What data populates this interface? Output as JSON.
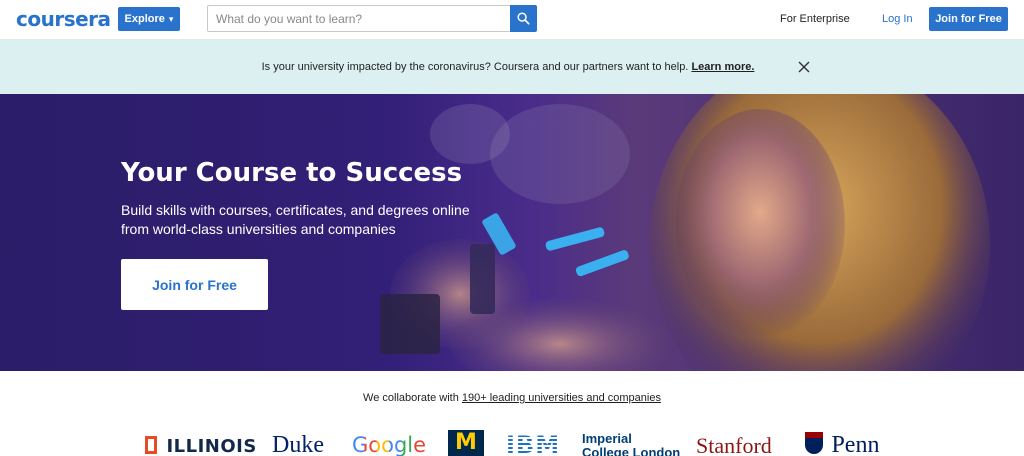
{
  "header": {
    "logo_text": "coursera",
    "explore_label": "Explore",
    "search_placeholder": "What do you want to learn?",
    "enterprise_label": "For Enterprise",
    "login_label": "Log In",
    "join_label": "Join for Free"
  },
  "banner": {
    "message": "Is your university impacted by the coronavirus? Coursera and our partners want to help.",
    "link_label": "Learn more."
  },
  "hero": {
    "title": "Your Course to Success",
    "subtitle": "Build skills with courses, certificates, and degrees online from world-class universities and companies",
    "cta_label": "Join for Free"
  },
  "partners": {
    "prefix": "We collaborate with",
    "link_label": "190+ leading universities and companies",
    "logos": [
      "ILLINOIS",
      "Duke",
      "Google",
      "M",
      "IBM",
      "Imperial College London",
      "Stanford",
      "Penn"
    ]
  },
  "colors": {
    "brand": "#2a73cc",
    "banner_bg": "#dcf0f2",
    "hero_bg": "#2c1d69",
    "illinois": "#e84a27",
    "stanford": "#8c1515",
    "penn": "#011f5b"
  }
}
